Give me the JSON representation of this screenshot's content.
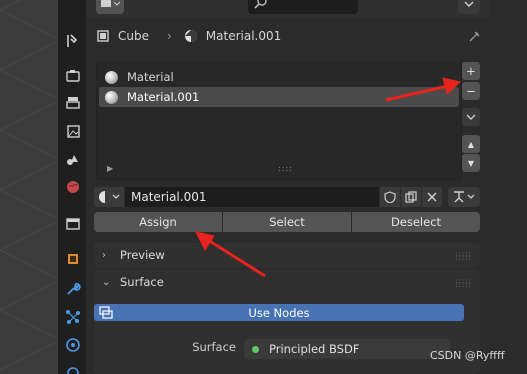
{
  "breadcrumb": {
    "object": "Cube",
    "separator": "›",
    "material": "Material.001"
  },
  "slots": [
    {
      "label": "Material",
      "selected": false
    },
    {
      "label": "Material.001",
      "selected": true
    }
  ],
  "slot_list_grip": "::::",
  "side_buttons": {
    "add": "+",
    "remove": "−",
    "menu": "⌄",
    "up": "▲",
    "down": "▼"
  },
  "datablock": {
    "name": "Material.001"
  },
  "assign_buttons": {
    "assign": "Assign",
    "select": "Select",
    "deselect": "Deselect"
  },
  "panels": {
    "preview": "Preview",
    "surface": "Surface"
  },
  "use_nodes_label": "Use Nodes",
  "surface": {
    "label": "Surface",
    "value": "Principled BSDF"
  },
  "watermark": "CSDN @Ryffff",
  "colors": {
    "accent": "#4772b3",
    "annotation": "#e8221c",
    "shader_socket": "#63c763"
  }
}
